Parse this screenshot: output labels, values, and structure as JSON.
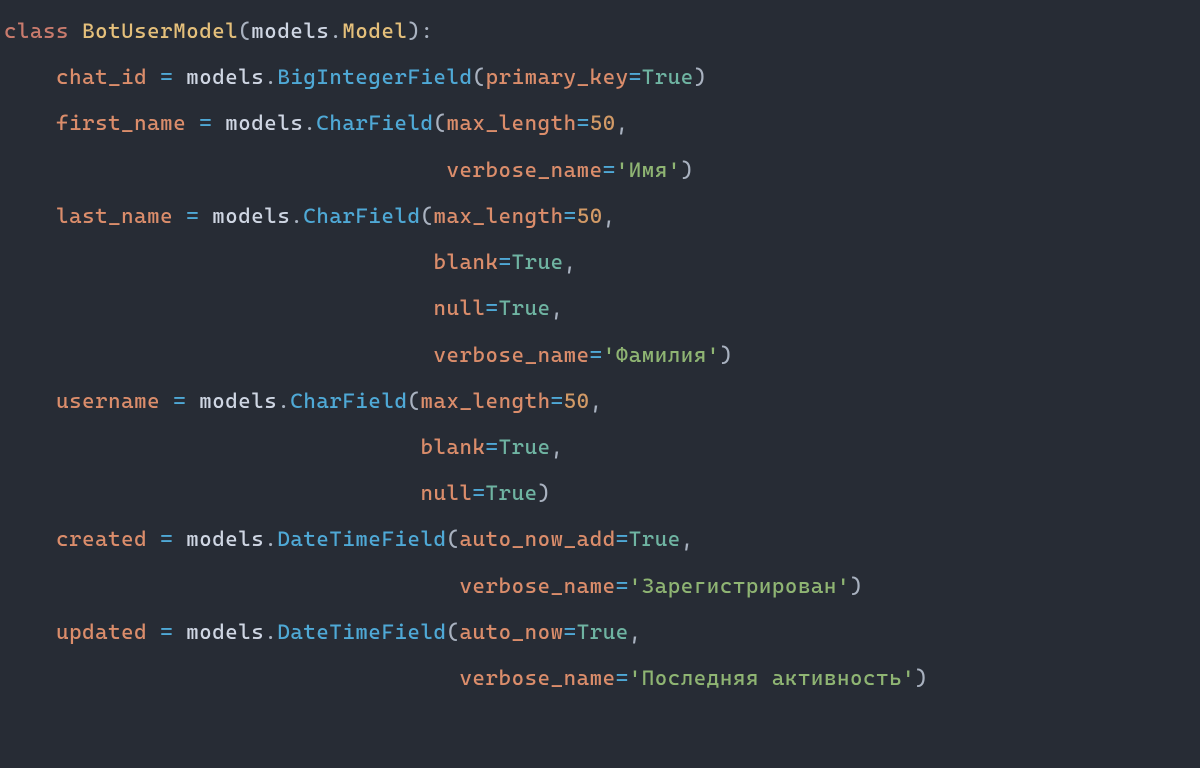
{
  "code": {
    "keyword_class": "class",
    "class_name": "BotUserModel",
    "base_module": "models",
    "base_class": "Model",
    "fields": {
      "chat_id": {
        "name": "chat_id",
        "call": "BigIntegerField",
        "kw1_name": "primary_key",
        "kw1_val": "True"
      },
      "first_name": {
        "name": "first_name",
        "call": "CharField",
        "kw1_name": "max_length",
        "kw1_val": "50",
        "kw2_name": "verbose_name",
        "kw2_val": "'Имя'"
      },
      "last_name": {
        "name": "last_name",
        "call": "CharField",
        "kw1_name": "max_length",
        "kw1_val": "50",
        "kw2_name": "blank",
        "kw2_val": "True",
        "kw3_name": "null",
        "kw3_val": "True",
        "kw4_name": "verbose_name",
        "kw4_val": "'Фамилия'"
      },
      "username": {
        "name": "username",
        "call": "CharField",
        "kw1_name": "max_length",
        "kw1_val": "50",
        "kw2_name": "blank",
        "kw2_val": "True",
        "kw3_name": "null",
        "kw3_val": "True"
      },
      "created": {
        "name": "created",
        "call": "DateTimeField",
        "kw1_name": "auto_now_add",
        "kw1_val": "True",
        "kw2_name": "verbose_name",
        "kw2_val": "'Зарегистрирован'"
      },
      "updated": {
        "name": "updated",
        "call": "DateTimeField",
        "kw1_name": "auto_now",
        "kw1_val": "True",
        "kw2_name": "verbose_name",
        "kw2_val": "'Последняя активность'"
      }
    }
  }
}
